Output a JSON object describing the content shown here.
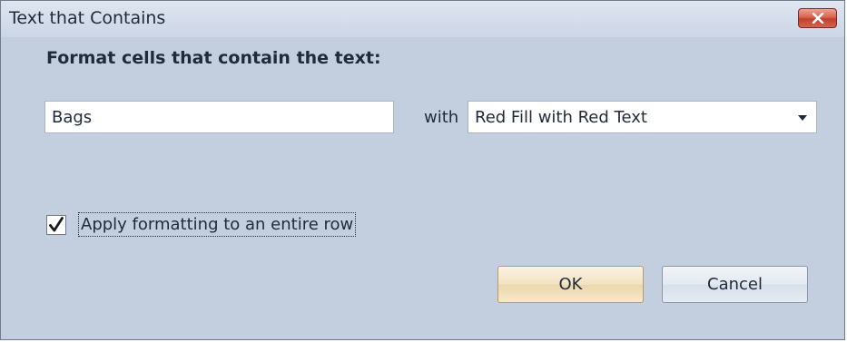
{
  "window": {
    "title": "Text that Contains",
    "close_icon": "close-icon"
  },
  "form": {
    "heading": "Format cells that contain the text:",
    "text_value": "Bags",
    "with_label": "with",
    "format_selected": "Red Fill with Red Text",
    "apply_row_label": "Apply formatting to an entire row",
    "apply_row_checked": true
  },
  "buttons": {
    "ok_label": "OK",
    "cancel_label": "Cancel"
  },
  "colors": {
    "dialog_bg": "#c3cfdf",
    "close_button": "#d9634e",
    "ok_button": "#f3e3c2"
  }
}
